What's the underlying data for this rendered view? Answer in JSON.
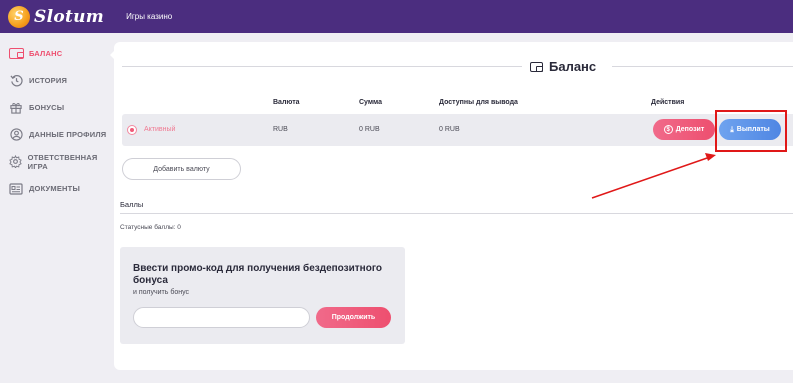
{
  "header": {
    "logo_glyph": "S",
    "logo_text": "Slotum",
    "nav_link": "Игры казино"
  },
  "sidebar": {
    "items": [
      {
        "label": "БАЛАНС",
        "icon": "wallet-icon",
        "active": true
      },
      {
        "label": "ИСТОРИЯ",
        "icon": "history-icon",
        "active": false
      },
      {
        "label": "БОНУСЫ",
        "icon": "gift-icon",
        "active": false
      },
      {
        "label": "ДАННЫЕ ПРОФИЛЯ",
        "icon": "user-icon",
        "active": false
      },
      {
        "label": "ОТВЕТСТВЕННАЯ ИГРА",
        "icon": "gear-icon",
        "active": false
      },
      {
        "label": "ДОКУМЕНТЫ",
        "icon": "document-icon",
        "active": false
      }
    ]
  },
  "main": {
    "title": "Баланс",
    "table": {
      "headers": {
        "currency": "Валюта",
        "amount": "Сумма",
        "withdrawable": "Доступны для вывода",
        "actions": "Действия"
      },
      "rows": [
        {
          "status": "Активный",
          "currency": "RUB",
          "amount": "0 RUB",
          "withdrawable": "0 RUB"
        }
      ]
    },
    "deposit_button": "Депозит",
    "payout_button": "Выплаты",
    "add_currency_button": "Добавить валюту",
    "points": {
      "label": "Баллы",
      "status_points": "Статусные баллы: 0"
    },
    "promo": {
      "title": "Ввести промо-код для получения бездепозитного бонуса",
      "subtitle": "и получить бонус",
      "input_value": "",
      "input_placeholder": "",
      "submit_button": "Продолжить"
    }
  },
  "colors": {
    "header": "#4b2d7f",
    "accent_pink": "#ee4f6f",
    "accent_blue": "#4f86e3",
    "annotation_red": "#e01818"
  }
}
